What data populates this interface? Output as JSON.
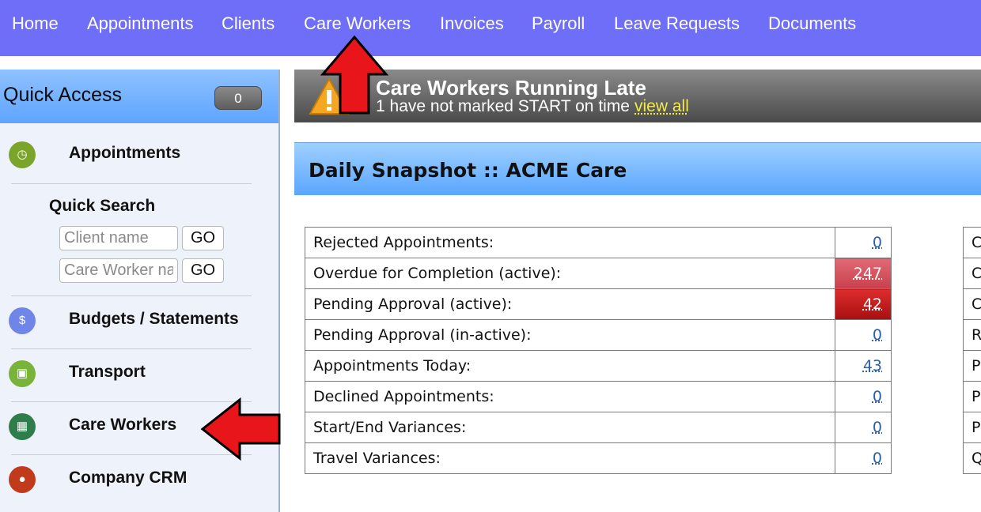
{
  "nav": {
    "items": [
      "Home",
      "Appointments",
      "Clients",
      "Care Workers",
      "Invoices",
      "Payroll",
      "Leave Requests",
      "Documents"
    ]
  },
  "sidebar": {
    "title": "Quick Access",
    "badge": "0",
    "items": [
      {
        "label": "Appointments",
        "icon": "clock-icon"
      },
      {
        "label": "Budgets / Statements",
        "icon": "money-icon"
      },
      {
        "label": "Transport",
        "icon": "bus-icon"
      },
      {
        "label": "Care Workers",
        "icon": "care-workers-icon"
      },
      {
        "label": "Company CRM",
        "icon": "crm-icon"
      }
    ],
    "quick_search": {
      "title": "Quick Search",
      "client_placeholder": "Client name",
      "worker_placeholder": "Care Worker name",
      "go_label": "GO"
    }
  },
  "alert": {
    "title": "Care Workers Running Late",
    "subtitle": "1 have not marked START on time",
    "link": "view all"
  },
  "snapshot": {
    "title": "Daily Snapshot :: ACME Care"
  },
  "stats": [
    {
      "label": "Rejected Appointments:",
      "value": "0"
    },
    {
      "label": "Overdue for Completion (active):",
      "value": "247"
    },
    {
      "label": "Pending Approval (active):",
      "value": "42"
    },
    {
      "label": "Pending Approval (in-active):",
      "value": "0"
    },
    {
      "label": "Appointments Today:",
      "value": "43"
    },
    {
      "label": "Declined Appointments:",
      "value": "0"
    },
    {
      "label": "Start/End Variances:",
      "value": "0"
    },
    {
      "label": "Travel Variances:",
      "value": "0"
    }
  ],
  "right_table_initials": [
    "C",
    "C",
    "C",
    "R",
    "P",
    "P",
    "P",
    "Q"
  ],
  "colors": {
    "nav_bg": "#6f6ef8",
    "alert_red": "#a80f10",
    "arrow_red": "#e8151a"
  }
}
